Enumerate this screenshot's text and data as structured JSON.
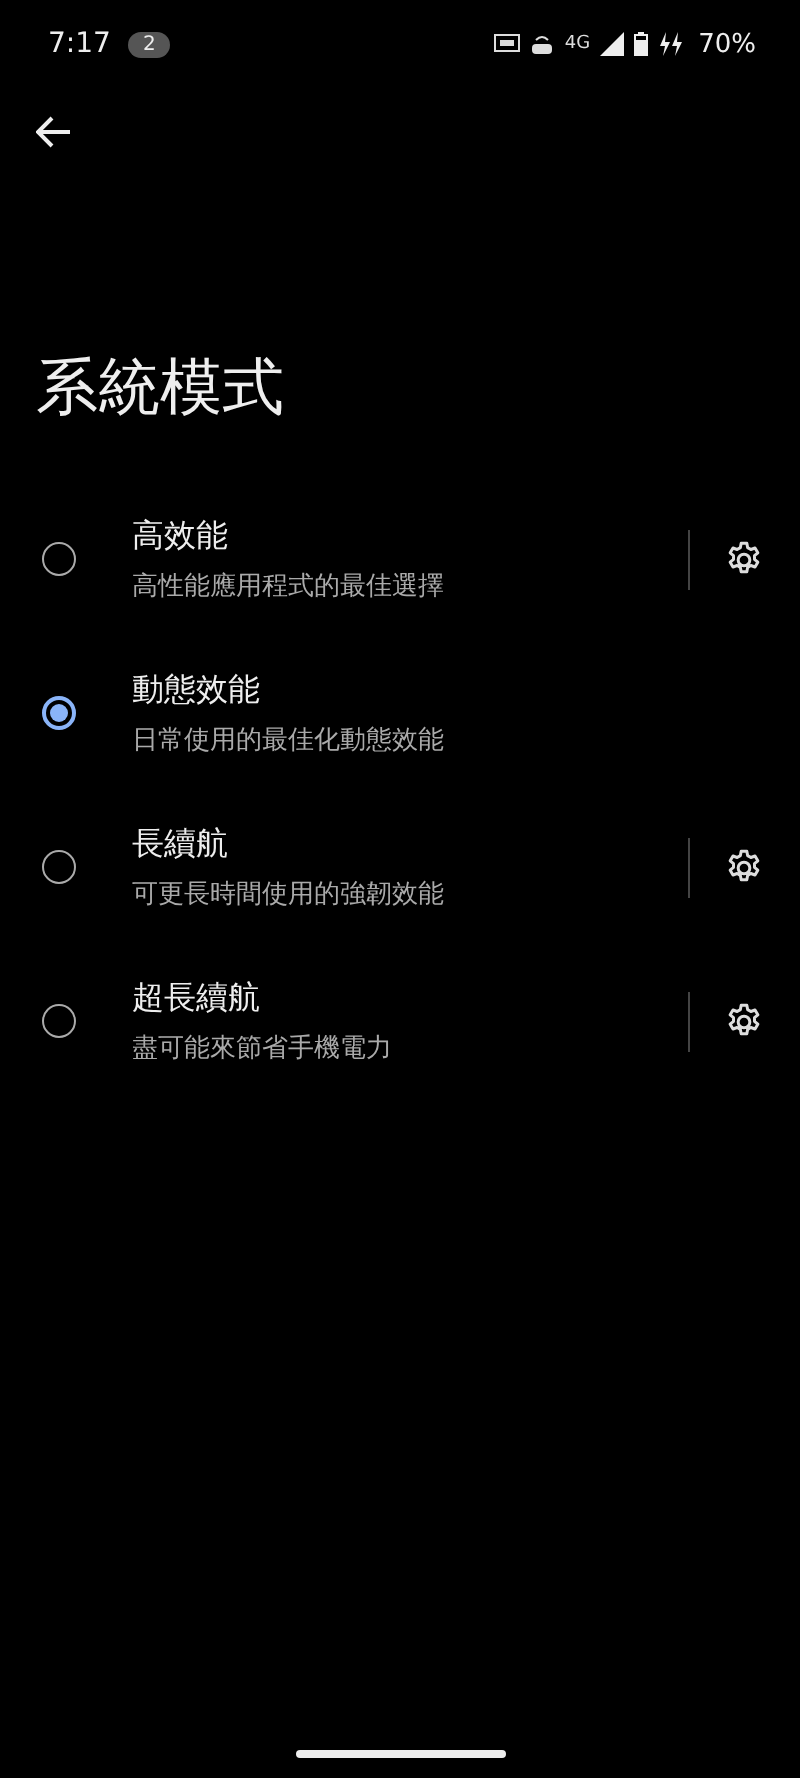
{
  "status_bar": {
    "time": "7:17",
    "notification_count": "2",
    "network": "4G",
    "battery": "70%"
  },
  "title": "系統模式",
  "modes": [
    {
      "title": "高效能",
      "subtitle": "高性能應用程式的最佳選擇",
      "selected": false,
      "settings": true
    },
    {
      "title": "動態效能",
      "subtitle": "日常使用的最佳化動態效能",
      "selected": true,
      "settings": false
    },
    {
      "title": "長續航",
      "subtitle": "可更長時間使用的強韌效能",
      "selected": false,
      "settings": true
    },
    {
      "title": "超長續航",
      "subtitle": "盡可能來節省手機電力",
      "selected": false,
      "settings": true
    }
  ]
}
